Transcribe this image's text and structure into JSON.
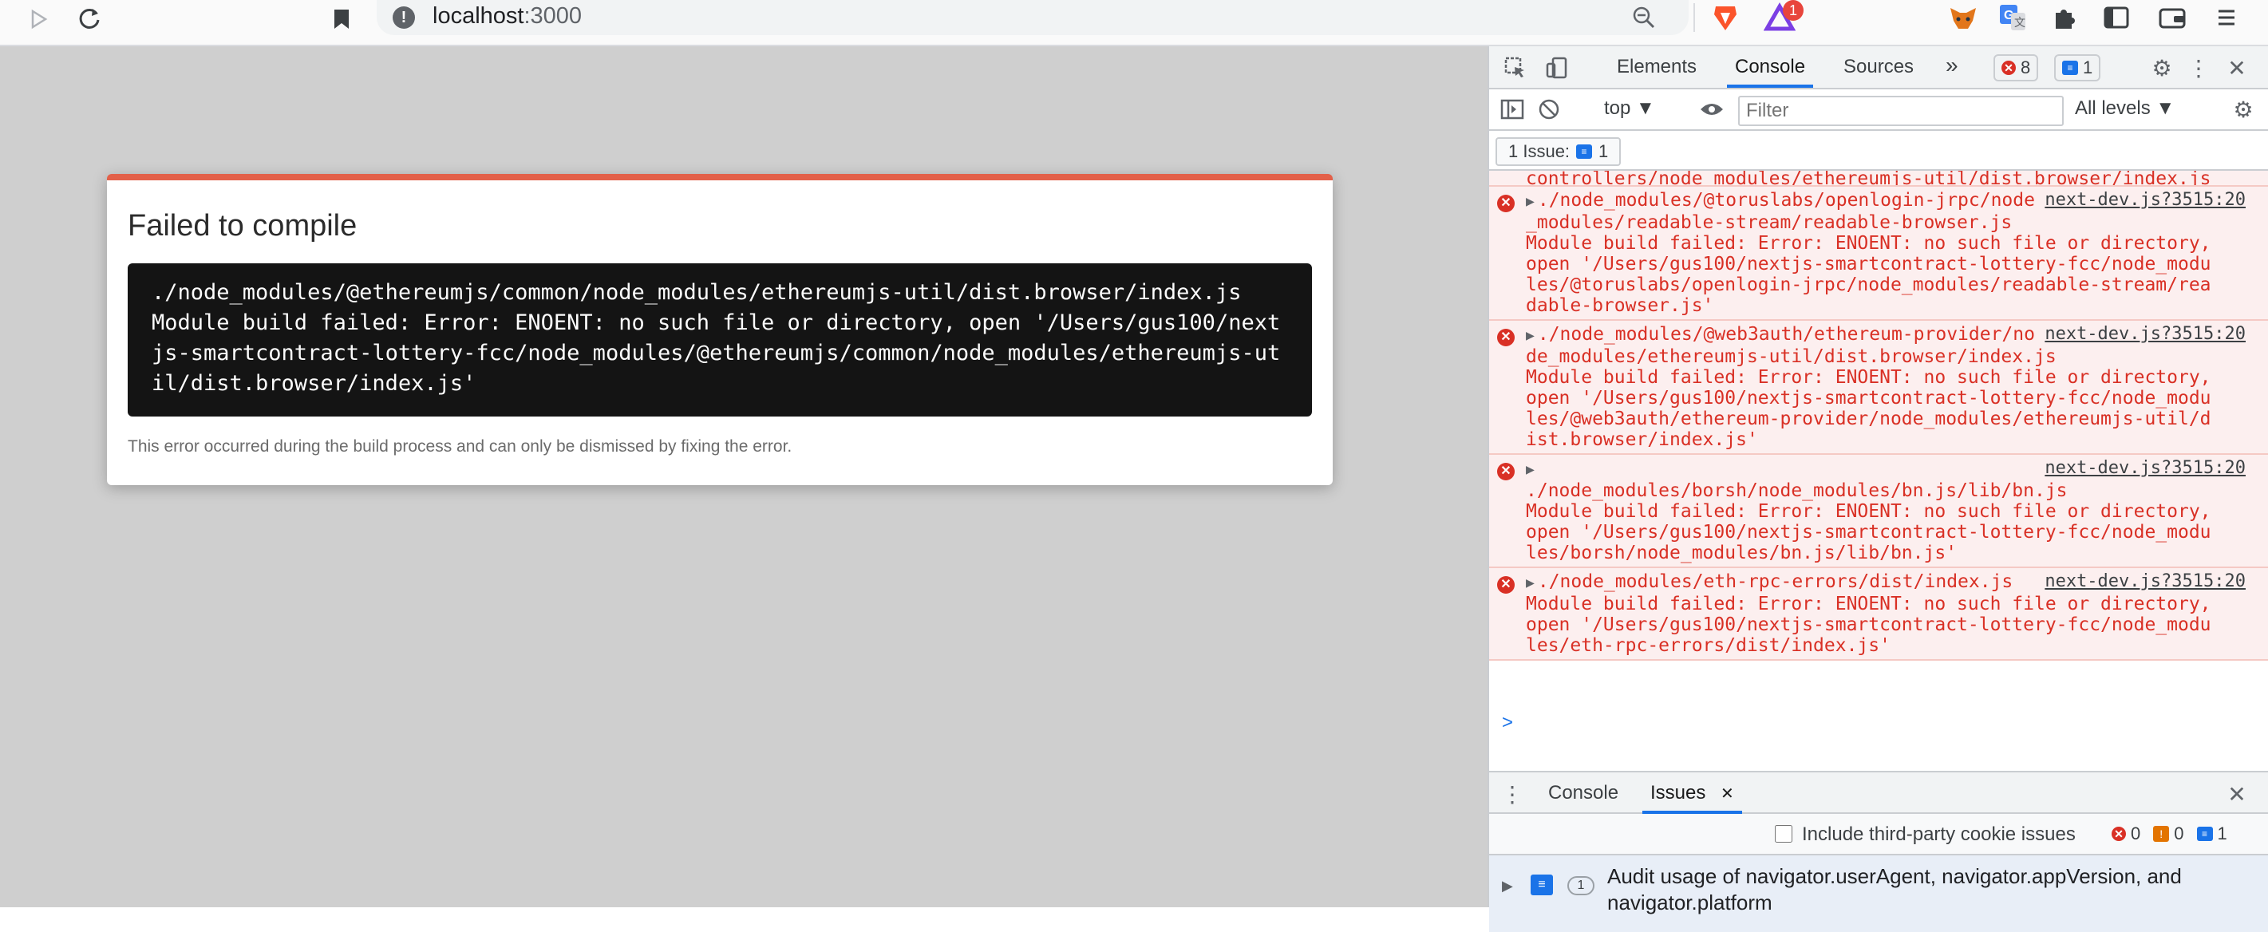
{
  "browser": {
    "url_host": "localhost",
    "url_port": ":3000",
    "notification_count": "1"
  },
  "overlay": {
    "title": "Failed to compile",
    "error_lines": [
      "./node_modules/@ethereumjs/common/node_modules/ethereumjs-util/dist.browser/index.js",
      "Module build failed: Error: ENOENT: no such file or directory, open '/Users/gus100/nextjs-smartcontract-lottery-fcc/node_modules/@ethereumjs/common/node_modules/ethereumjs-util/dist.browser/index.js'"
    ],
    "footnote": "This error occurred during the build process and can only be dismissed by fixing the error."
  },
  "devtools": {
    "tabs": [
      "Elements",
      "Console",
      "Sources"
    ],
    "more": "»",
    "error_count": "8",
    "message_count": "1",
    "filterbar": {
      "context": "top",
      "filter_placeholder": "Filter",
      "levels": "All levels"
    },
    "issues_button": "1 Issue:",
    "issues_count": "1",
    "partial_line": "controllers/node_modules/ethereumjs-util/dist.browser/index.js",
    "log": [
      {
        "path": "./node_modules/@toruslabs/openlogin-jrpc/node_modules/readable-stream/readable-browser.js",
        "message": "Module build failed: Error: ENOENT: no such file or directory, open '/Users/gus100/nextjs-smartcontract-lottery-fcc/node_modules/@toruslabs/openlogin-jrpc/node_modules/readable-stream/readable-browser.js'",
        "source": "next-dev.js?3515:20"
      },
      {
        "path": "./node_modules/@web3auth/ethereum-provider/node_modules/ethereumjs-util/dist.browser/index.js",
        "message": "Module build failed: Error: ENOENT: no such file or directory, open '/Users/gus100/nextjs-smartcontract-lottery-fcc/node_modules/@web3auth/ethereum-provider/node_modules/ethereumjs-util/dist.browser/index.js'",
        "source": "next-dev.js?3515:20"
      },
      {
        "path": "./node_modules/borsh/node_modules/bn.js/lib/bn.js",
        "message": "Module build failed: Error: ENOENT: no such file or directory, open '/Users/gus100/nextjs-smartcontract-lottery-fcc/node_modules/borsh/node_modules/bn.js/lib/bn.js'",
        "source": "next-dev.js?3515:20"
      },
      {
        "path": "./node_modules/eth-rpc-errors/dist/index.js",
        "message": "Module build failed: Error: ENOENT: no such file or directory, open '/Users/gus100/nextjs-smartcontract-lottery-fcc/node_modules/eth-rpc-errors/dist/index.js'",
        "source": "next-dev.js?3515:20"
      }
    ],
    "prompt": ">",
    "drawer": {
      "tabs": [
        "Console",
        "Issues"
      ],
      "cookie_label": "Include third-party cookie issues",
      "err_count": "0",
      "warn_count": "0",
      "info_count": "1",
      "issue_count": "1",
      "issue_text": "Audit usage of navigator.userAgent, navigator.appVersion, and navigator.platform"
    }
  },
  "colors": {
    "error_red": "#d93025",
    "accent_blue": "#1a73e8",
    "overlay_top": "#e36049"
  }
}
